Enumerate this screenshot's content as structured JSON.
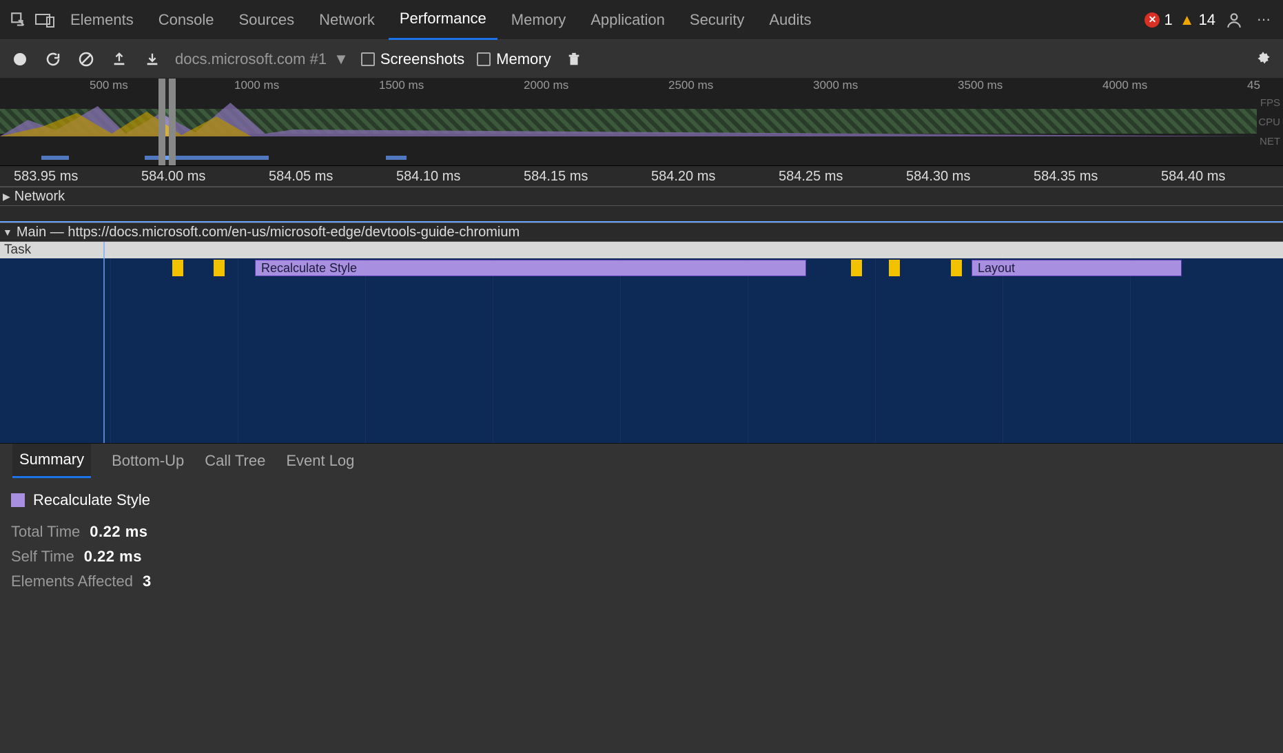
{
  "top_tabs": {
    "items": [
      "Elements",
      "Console",
      "Sources",
      "Network",
      "Performance",
      "Memory",
      "Application",
      "Security",
      "Audits"
    ],
    "active_index": 4
  },
  "top_right": {
    "error_count": "1",
    "warning_count": "14"
  },
  "toolbar": {
    "recording_title": "docs.microsoft.com #1",
    "screenshots_label": "Screenshots",
    "memory_label": "Memory"
  },
  "overview": {
    "ticks": [
      "500 ms",
      "1000 ms",
      "1500 ms",
      "2000 ms",
      "2500 ms",
      "3000 ms",
      "3500 ms",
      "4000 ms",
      "45"
    ],
    "right_labels": [
      "FPS",
      "CPU",
      "NET"
    ]
  },
  "detail_ruler": {
    "ticks": [
      "583.95 ms",
      "584.00 ms",
      "584.05 ms",
      "584.10 ms",
      "584.15 ms",
      "584.20 ms",
      "584.25 ms",
      "584.30 ms",
      "584.35 ms",
      "584.40 ms"
    ]
  },
  "tracks": {
    "network_label": "Network",
    "main_label": "Main — https://docs.microsoft.com/en-us/microsoft-edge/devtools-guide-chromium",
    "task_label": "Task",
    "events": {
      "recalculate_style": "Recalculate Style",
      "layout": "Layout"
    }
  },
  "detail_tabs": {
    "items": [
      "Summary",
      "Bottom-Up",
      "Call Tree",
      "Event Log"
    ],
    "active_index": 0
  },
  "summary": {
    "title": "Recalculate Style",
    "rows": [
      {
        "label": "Total Time",
        "value": "0.22 ms"
      },
      {
        "label": "Self Time",
        "value": "0.22 ms"
      },
      {
        "label": "Elements Affected",
        "value": "3"
      }
    ]
  },
  "colors": {
    "style": "#a98fe0",
    "script": "#f2c200",
    "main_bg": "#0d2a57"
  }
}
